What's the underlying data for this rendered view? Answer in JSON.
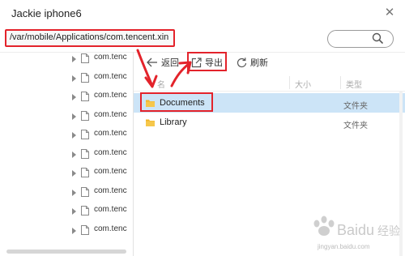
{
  "window": {
    "title": "Jackie iphone6",
    "close_glyph": "✕"
  },
  "path": {
    "value": "/var/mobile/Applications/com.tencent.xin"
  },
  "search": {
    "placeholder": ""
  },
  "tree": {
    "items": [
      {
        "label": "com.tenc"
      },
      {
        "label": "com.tenc"
      },
      {
        "label": "com.tenc"
      },
      {
        "label": "com.tenc"
      },
      {
        "label": "com.tenc"
      },
      {
        "label": "com.tenc"
      },
      {
        "label": "com.tenc"
      },
      {
        "label": "com.tenc"
      },
      {
        "label": "com.tenc"
      },
      {
        "label": "com.tenc"
      }
    ]
  },
  "toolbar": {
    "back_label": "返回",
    "export_label": "导出",
    "refresh_label": "刷新"
  },
  "columns": {
    "name": "名",
    "size": "大小",
    "type": "类型"
  },
  "files": [
    {
      "name": "Documents",
      "type": "文件夹",
      "icon": "folder-icon",
      "selected": true
    },
    {
      "name": "Library",
      "type": "文件夹",
      "icon": "folder-icon",
      "selected": false
    }
  ],
  "watermark": {
    "brand": "Baidu",
    "brand_cn": "经验",
    "url": "jingyan.baidu.com"
  },
  "colors": {
    "highlight_red": "#e3232b",
    "selection_blue": "#cce4f7",
    "folder_yellow": "#f0b429"
  }
}
